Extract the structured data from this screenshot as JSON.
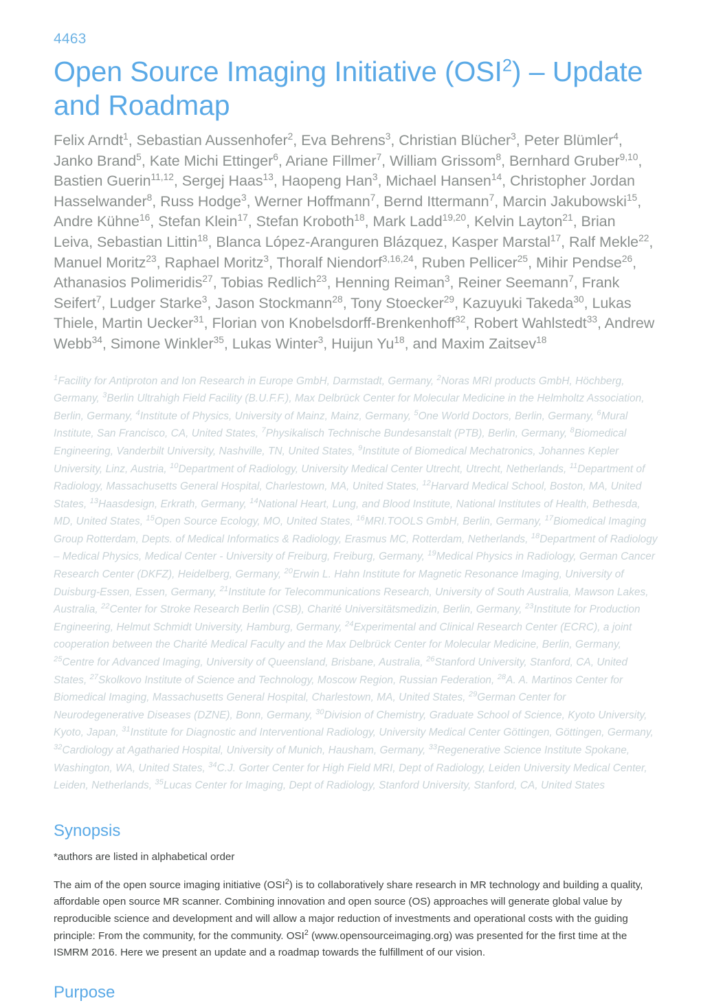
{
  "document": {
    "abstract_number": "4463",
    "title_plain": "Open Source Imaging Initiative (OSI²) – Update and Roadmap",
    "title_part1": "Open Source Imaging Initiative (OSI",
    "title_sup": "2",
    "title_part2": ") – Update and Roadmap",
    "authors": "Felix Arndt1, Sebastian Aussenhofer2, Eva Behrens3, Christian Blücher3, Peter Blümler4, Janko Brand5, Kate Michi Ettinger6, Ariane Fillmer7, William Grissom8, Bernhard Gruber9,10, Bastien Guerin11,12, Sergej Haas13, Haopeng Han3, Michael Hansen14, Christopher Jordan Hasselwander8, Russ Hodge3, Werner Hoffmann7, Bernd Ittermann7, Marcin Jakubowski15, Andre Kühne16, Stefan Klein17, Stefan Kroboth18, Mark Ladd19,20, Kelvin Layton21, Brian Leiva, Sebastian Littin18, Blanca López-Aranguren Blázquez, Kasper Marstal17, Ralf Mekle22, Manuel Moritz23, Raphael Moritz3, Thoralf Niendorf3,16,24, Ruben Pellicer25, Mihir Pendse26, Athanasios Polimeridis27, Tobias Redlich23, Henning Reiman3, Reiner Seemann7, Frank Seifert7, Ludger Starke3, Jason Stockmann28, Tony Stoecker29, Kazuyuki Takeda30, Lukas Thiele, Martin Uecker31, Florian von Knobelsdorff-Brenkenhoff32, Robert Wahlstedt33, Andrew Webb34, Simone Winkler35, Lukas Winter3, Huijun Yu18, and Maxim Zaitsev18",
    "author_items": [
      {
        "name": "Felix Arndt",
        "sup": "1",
        "sep": ", "
      },
      {
        "name": "Sebastian Aussenhofer",
        "sup": "2",
        "sep": ", "
      },
      {
        "name": "Eva Behrens",
        "sup": "3",
        "sep": ", "
      },
      {
        "name": "Christian Blücher",
        "sup": "3",
        "sep": ", "
      },
      {
        "name": "Peter Blümler",
        "sup": "4",
        "sep": ", "
      },
      {
        "name": "Janko Brand",
        "sup": "5",
        "sep": ", "
      },
      {
        "name": "Kate Michi Ettinger",
        "sup": "6",
        "sep": ", "
      },
      {
        "name": "Ariane Fillmer",
        "sup": "7",
        "sep": ", "
      },
      {
        "name": "William Grissom",
        "sup": "8",
        "sep": ", "
      },
      {
        "name": "Bernhard Gruber",
        "sup": "9,10",
        "sep": ", "
      },
      {
        "name": "Bastien Guerin",
        "sup": "11,12",
        "sep": ", "
      },
      {
        "name": "Sergej Haas",
        "sup": "13",
        "sep": ", "
      },
      {
        "name": "Haopeng Han",
        "sup": "3",
        "sep": ", "
      },
      {
        "name": "Michael Hansen",
        "sup": "14",
        "sep": ", "
      },
      {
        "name": "Christopher Jordan Hasselwander",
        "sup": "8",
        "sep": ", "
      },
      {
        "name": "Russ Hodge",
        "sup": "3",
        "sep": ", "
      },
      {
        "name": "Werner Hoffmann",
        "sup": "7",
        "sep": ", "
      },
      {
        "name": "Bernd Ittermann",
        "sup": "7",
        "sep": ", "
      },
      {
        "name": "Marcin Jakubowski",
        "sup": "15",
        "sep": ", "
      },
      {
        "name": "Andre Kühne",
        "sup": "16",
        "sep": ", "
      },
      {
        "name": "Stefan Klein",
        "sup": "17",
        "sep": ", "
      },
      {
        "name": "Stefan Kroboth",
        "sup": "18",
        "sep": ", "
      },
      {
        "name": "Mark Ladd",
        "sup": "19,20",
        "sep": ", "
      },
      {
        "name": "Kelvin Layton",
        "sup": "21",
        "sep": ", "
      },
      {
        "name": "Brian Leiva",
        "sup": "",
        "sep": ", "
      },
      {
        "name": "Sebastian Littin",
        "sup": "18",
        "sep": ", "
      },
      {
        "name": "Blanca López-Aranguren Blázquez",
        "sup": "",
        "sep": ", "
      },
      {
        "name": "Kasper Marstal",
        "sup": "17",
        "sep": ", "
      },
      {
        "name": "Ralf Mekle",
        "sup": "22",
        "sep": ", "
      },
      {
        "name": "Manuel Moritz",
        "sup": "23",
        "sep": ", "
      },
      {
        "name": "Raphael Moritz",
        "sup": "3",
        "sep": ", "
      },
      {
        "name": "Thoralf Niendorf",
        "sup": "3,16,24",
        "sep": ", "
      },
      {
        "name": "Ruben Pellicer",
        "sup": "25",
        "sep": ", "
      },
      {
        "name": "Mihir Pendse",
        "sup": "26",
        "sep": ", "
      },
      {
        "name": "Athanasios Polimeridis",
        "sup": "27",
        "sep": ", "
      },
      {
        "name": "Tobias Redlich",
        "sup": "23",
        "sep": ", "
      },
      {
        "name": "Henning Reiman",
        "sup": "3",
        "sep": ", "
      },
      {
        "name": "Reiner Seemann",
        "sup": "7",
        "sep": ", "
      },
      {
        "name": "Frank Seifert",
        "sup": "7",
        "sep": ", "
      },
      {
        "name": "Ludger Starke",
        "sup": "3",
        "sep": ", "
      },
      {
        "name": "Jason Stockmann",
        "sup": "28",
        "sep": ", "
      },
      {
        "name": "Tony Stoecker",
        "sup": "29",
        "sep": ", "
      },
      {
        "name": "Kazuyuki Takeda",
        "sup": "30",
        "sep": ", "
      },
      {
        "name": "Lukas Thiele",
        "sup": "",
        "sep": ", "
      },
      {
        "name": "Martin Uecker",
        "sup": "31",
        "sep": ", "
      },
      {
        "name": "Florian von Knobelsdorff-Brenkenhoff",
        "sup": "32",
        "sep": ", "
      },
      {
        "name": "Robert Wahlstedt",
        "sup": "33",
        "sep": ", "
      },
      {
        "name": "Andrew Webb",
        "sup": "34",
        "sep": ", "
      },
      {
        "name": "Simone Winkler",
        "sup": "35",
        "sep": ", "
      },
      {
        "name": "Lukas Winter",
        "sup": "3",
        "sep": ", "
      },
      {
        "name": "Huijun Yu",
        "sup": "18",
        "sep": ", and "
      },
      {
        "name": "Maxim Zaitsev",
        "sup": "18",
        "sep": ""
      }
    ],
    "affiliations": [
      {
        "num": "1",
        "text": "Facility for Antiproton and Ion Research in Europe GmbH, Darmstadt, Germany",
        "sep": ", "
      },
      {
        "num": "2",
        "text": "Noras MRI products GmbH, Höchberg, Germany",
        "sep": ", "
      },
      {
        "num": "3",
        "text": "Berlin Ultrahigh Field Facility (B.U.F.F.), Max Delbrück Center for Molecular Medicine in the Helmholtz Association, Berlin, Germany",
        "sep": ", "
      },
      {
        "num": "4",
        "text": "Institute of Physics, University of Mainz, Mainz, Germany",
        "sep": ", "
      },
      {
        "num": "5",
        "text": "One World Doctors, Berlin, Germany",
        "sep": ", "
      },
      {
        "num": "6",
        "text": "Mural Institute, San Francisco, CA, United States",
        "sep": ", "
      },
      {
        "num": "7",
        "text": "Physikalisch Technische Bundesanstalt (PTB), Berlin, Germany",
        "sep": ", "
      },
      {
        "num": "8",
        "text": "Biomedical Engineering, Vanderbilt University, Nashville, TN, United States",
        "sep": ", "
      },
      {
        "num": "9",
        "text": "Institute of Biomedical Mechatronics, Johannes Kepler University, Linz, Austria",
        "sep": ", "
      },
      {
        "num": "10",
        "text": "Department of Radiology, University Medical Center Utrecht, Utrecht, Netherlands",
        "sep": ", "
      },
      {
        "num": "11",
        "text": "Department of Radiology, Massachusetts General Hospital, Charlestown, MA, United States",
        "sep": ", "
      },
      {
        "num": "12",
        "text": "Harvard Medical School, Boston, MA, United States",
        "sep": ", "
      },
      {
        "num": "13",
        "text": "Haasdesign, Erkrath, Germany",
        "sep": ", "
      },
      {
        "num": "14",
        "text": "National Heart, Lung, and Blood Institute, National Institutes of Health, Bethesda, MD, United States",
        "sep": ", "
      },
      {
        "num": "15",
        "text": "Open Source Ecology, MO, United States",
        "sep": ", "
      },
      {
        "num": "16",
        "text": "MRI.TOOLS GmbH, Berlin, Germany",
        "sep": ", "
      },
      {
        "num": "17",
        "text": "Biomedical Imaging Group Rotterdam, Depts. of Medical Informatics & Radiology, Erasmus MC, Rotterdam, Netherlands",
        "sep": ", "
      },
      {
        "num": "18",
        "text": "Department of Radiology – Medical Physics, Medical Center - University of Freiburg, Freiburg, Germany",
        "sep": ", "
      },
      {
        "num": "19",
        "text": "Medical Physics in Radiology, German Cancer Research Center (DKFZ), Heidelberg, Germany",
        "sep": ", "
      },
      {
        "num": "20",
        "text": "Erwin L. Hahn Institute for Magnetic Resonance Imaging, University of Duisburg-Essen, Essen, Germany",
        "sep": ", "
      },
      {
        "num": "21",
        "text": "Institute for Telecommunications Research, University of South Australia, Mawson Lakes, Australia",
        "sep": ", "
      },
      {
        "num": "22",
        "text": "Center for Stroke Research Berlin (CSB), Charité Universitätsmedizin, Berlin, Germany",
        "sep": ", "
      },
      {
        "num": "23",
        "text": "Institute for Production Engineering, Helmut Schmidt University, Hamburg, Germany",
        "sep": ", "
      },
      {
        "num": "24",
        "text": "Experimental and Clinical Research Center (ECRC), a joint cooperation between the Charité Medical Faculty and the Max Delbrück Center for Molecular Medicine, Berlin, Germany",
        "sep": ", "
      },
      {
        "num": "25",
        "text": "Centre for Advanced Imaging, University of Queensland, Brisbane, Australia",
        "sep": ", "
      },
      {
        "num": "26",
        "text": "Stanford University, Stanford, CA, United States",
        "sep": ", "
      },
      {
        "num": "27",
        "text": "Skolkovo Institute of Science and Technology, Moscow Region, Russian Federation",
        "sep": ", "
      },
      {
        "num": "28",
        "text": "A. A. Martinos Center for Biomedical Imaging, Massachusetts General Hospital, Charlestown, MA, United States",
        "sep": ", "
      },
      {
        "num": "29",
        "text": "German Center for Neurodegenerative Diseases (DZNE), Bonn, Germany",
        "sep": ", "
      },
      {
        "num": "30",
        "text": "Division of Chemistry, Graduate School of Science, Kyoto University, Kyoto, Japan",
        "sep": ", "
      },
      {
        "num": "31",
        "text": "Institute for Diagnostic and Interventional Radiology, University Medical Center Göttingen, Göttingen, Germany",
        "sep": ", "
      },
      {
        "num": "32",
        "text": "Cardiology at Agatharied Hospital, University of Munich, Hausham, Germany",
        "sep": ", "
      },
      {
        "num": "33",
        "text": "Regenerative Science Institute Spokane, Washington, WA, United States",
        "sep": ", "
      },
      {
        "num": "34",
        "text": "C.J. Gorter Center for High Field MRI, Dept of Radiology, Leiden University Medical Center, Leiden, Netherlands",
        "sep": ", "
      },
      {
        "num": "35",
        "text": "Lucas Center for Imaging, Dept of Radiology, Stanford University, Stanford, CA, United States",
        "sep": ""
      }
    ],
    "sections": [
      {
        "heading": "Synopsis",
        "note": "*authors are listed in alphabetical order",
        "paragraph_part1": "The aim of the open source imaging initiative (OSI",
        "paragraph_sup1": "2",
        "paragraph_part2": ") is to collaboratively share research in MR technology and building a quality, affordable open source MR scanner. Combining innovation and open source (OS) approaches will generate global value by reproducible science and development and will allow a major reduction of investments and operational costs with the guiding principle: From the community, for the community. OSI",
        "paragraph_sup2": "2",
        "paragraph_part3": " (www.opensourceimaging.org) was presented for the first time at the ISMRM 2016. Here we present an update and a roadmap towards the fulfillment of our vision."
      },
      {
        "heading": "Purpose"
      }
    ],
    "colors": {
      "accent_blue": "#5aa9e6",
      "abstract_number_blue": "#6eb3e4",
      "author_gray": "#8a8f8d",
      "affiliation_gray": "#c7d2d6",
      "body_text": "#3e4240",
      "page_background": "#ffffff"
    }
  }
}
